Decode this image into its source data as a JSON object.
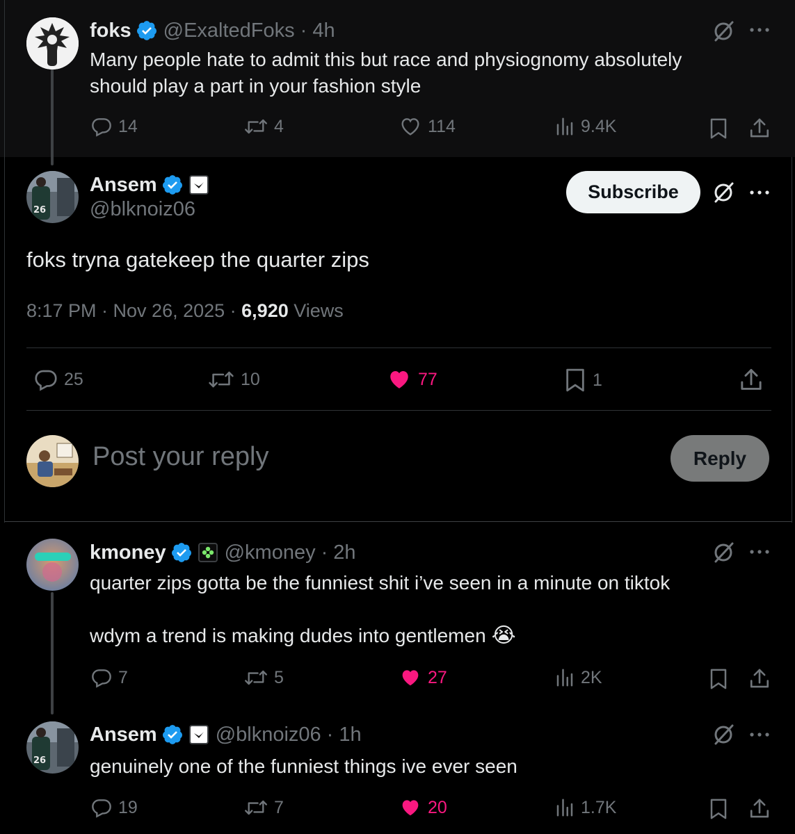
{
  "post1": {
    "name": "foks",
    "handle": "@ExaltedFoks",
    "time": "· 4h",
    "text": "Many people hate to admit this but race and physiognomy absolutely should play a part in your fashion style",
    "replies": "14",
    "reposts": "4",
    "likes": "114",
    "views": "9.4K"
  },
  "main": {
    "name": "Ansem",
    "handle": "@blknoiz06",
    "subscribe_label": "Subscribe",
    "text": "foks tryna gatekeep the quarter zips",
    "time": "8:17 PM · Nov 26, 2025 · ",
    "views_count": "6,920",
    "views_label": " Views",
    "replies": "25",
    "reposts": "10",
    "likes": "77",
    "bookmarks": "1"
  },
  "composer": {
    "placeholder": "Post your reply",
    "reply_label": "Reply"
  },
  "reply1": {
    "name": "kmoney",
    "handle": "@kmoney",
    "time": "· 2h",
    "line1": "quarter zips gotta be the funniest shit i’ve seen in a minute on tiktok",
    "line2": "wdym a trend is making dudes into gentlemen",
    "emoji": "😭",
    "replies": "7",
    "reposts": "5",
    "likes": "27",
    "views": "2K"
  },
  "reply2": {
    "name": "Ansem",
    "handle": "@blknoiz06",
    "time": "· 1h",
    "text": "genuinely one of the funniest things ive ever seen",
    "replies": "19",
    "reposts": "7",
    "likes": "20",
    "views": "1.7K"
  },
  "colors": {
    "verified": "#1d9bf0",
    "like_active": "#f91880",
    "muted": "#71767b",
    "background": "#000000"
  },
  "icons": [
    "reply-icon",
    "repost-icon",
    "like-icon",
    "views-icon",
    "bookmark-icon",
    "share-icon",
    "grok-icon",
    "more-icon",
    "verified-icon"
  ]
}
